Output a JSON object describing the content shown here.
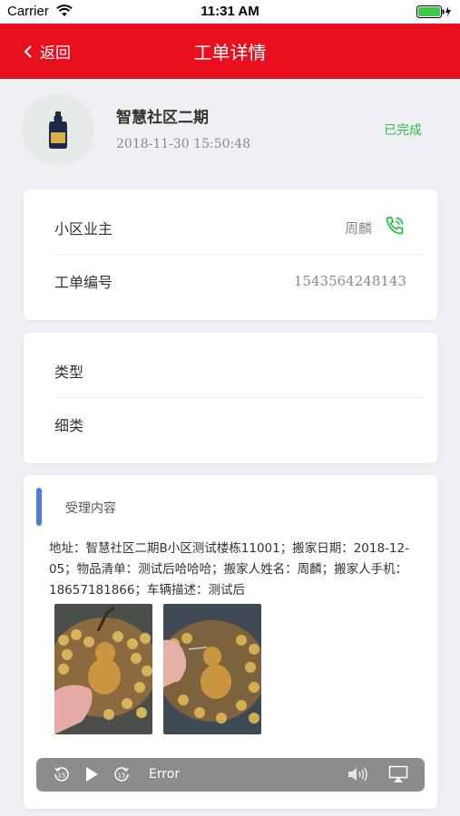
{
  "status_bar": {
    "carrier": "Carrier",
    "time": "11:31 AM"
  },
  "nav": {
    "back_label": "返回",
    "title": "工单详情"
  },
  "order": {
    "name": "智慧社区二期",
    "time": "2018-11-30 15:50:48",
    "status": "已完成"
  },
  "info_card": {
    "owner_label": "小区业主",
    "owner_value": "周麟",
    "number_label": "工单编号",
    "number_value": "1543564248143"
  },
  "type_card": {
    "type_label": "类型",
    "subtype_label": "细类"
  },
  "content": {
    "title": "受理内容",
    "text": "地址：智慧社区二期B小区测试楼栋11001；搬家日期：2018-12-05；物品清单：测试后哈哈哈；搬家人姓名：周麟；搬家人手机：18657181866；车辆描述：测试后"
  },
  "audio_player": {
    "error_text": "Error"
  },
  "colors": {
    "nav_red": "#e8101f",
    "status_green": "#2bbf4d",
    "accent_blue": "#4a7fe0"
  }
}
